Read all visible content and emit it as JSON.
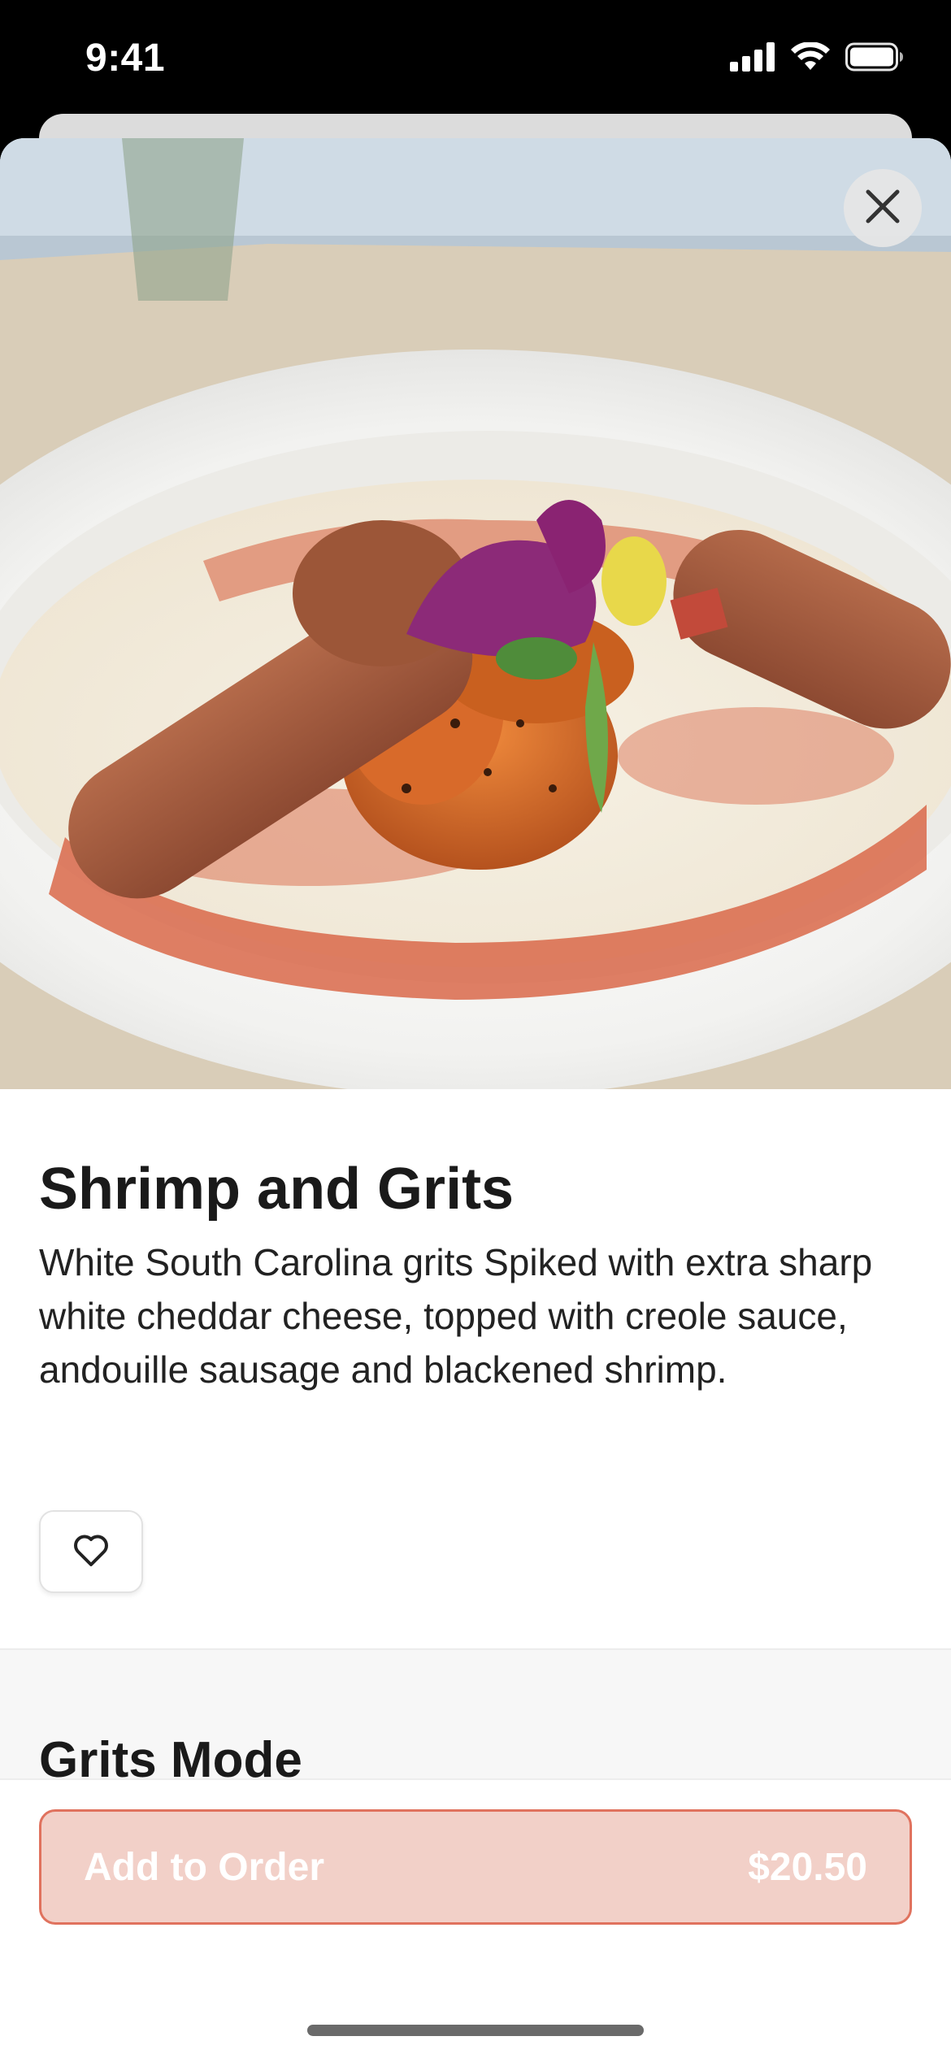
{
  "status_bar": {
    "time": "9:41"
  },
  "item": {
    "title": "Shrimp and Grits",
    "description": "White South Carolina grits Spiked with extra sharp white cheddar cheese, topped with creole sauce, andouille sausage and blackened shrimp."
  },
  "icons": {
    "close": "close-icon",
    "favorite": "heart-icon",
    "signal": "cellular-signal-icon",
    "wifi": "wifi-icon",
    "battery": "battery-icon"
  },
  "options": {
    "section_title": "Grits Mode"
  },
  "footer": {
    "add_label": "Add to Order",
    "price": "$20.50"
  },
  "colors": {
    "accent": "#e0725e",
    "button_fill": "#f2d0c8"
  }
}
